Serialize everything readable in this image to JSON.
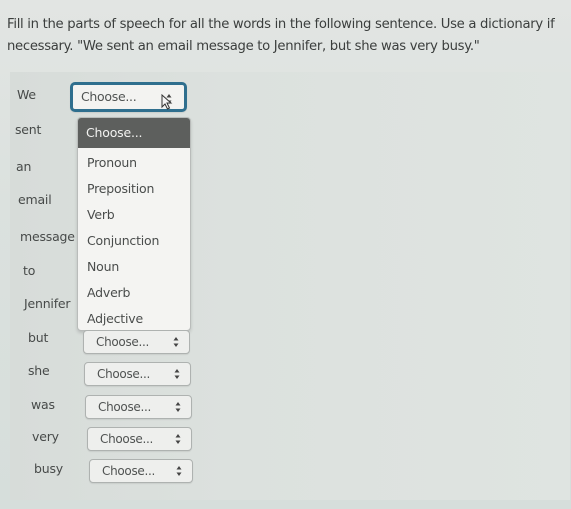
{
  "instructions": "Fill in the parts of speech for all the words in the following sentence. Use a dictionary if necessary. \"We sent an email message to Jennifer, but she was very busy.\"",
  "words": [
    {
      "word": "We",
      "selected": "Choose..."
    },
    {
      "word": "sent",
      "selected": "Choose..."
    },
    {
      "word": "an",
      "selected": "Choose..."
    },
    {
      "word": "email",
      "selected": "Choose..."
    },
    {
      "word": "message",
      "selected": "Choose..."
    },
    {
      "word": "to",
      "selected": "Choose..."
    },
    {
      "word": "Jennifer",
      "selected": "Choose..."
    },
    {
      "word": "but",
      "selected": "Choose..."
    },
    {
      "word": "she",
      "selected": "Choose..."
    },
    {
      "word": "was",
      "selected": "Choose..."
    },
    {
      "word": "very",
      "selected": "Choose..."
    },
    {
      "word": "busy",
      "selected": "Choose..."
    }
  ],
  "dropdown": {
    "open_for": "We",
    "options": [
      "Choose...",
      "Pronoun",
      "Preposition",
      "Verb",
      "Conjunction",
      "Noun",
      "Adverb",
      "Adjective"
    ],
    "highlighted": "Choose..."
  },
  "icons": {
    "select_arrows": "up-down-chevron-icon",
    "cursor": "mouse-pointer-icon"
  },
  "colors": {
    "focus_border": "#2f6f8e",
    "highlight_bg": "#5d5f5d"
  }
}
